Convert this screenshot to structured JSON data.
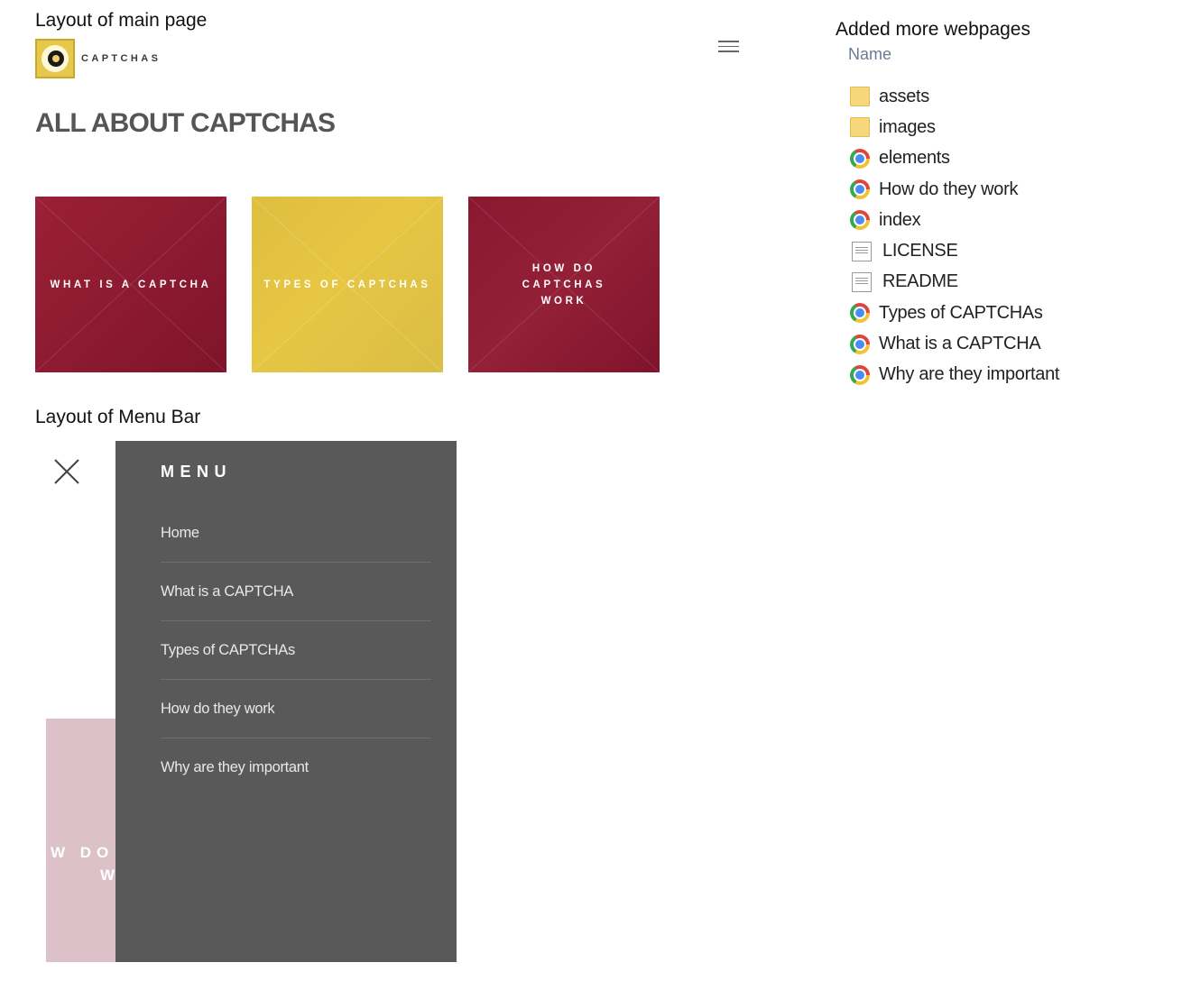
{
  "captions": {
    "main": "Layout of main page",
    "menu": "Layout of Menu Bar",
    "pages": "Added more webpages"
  },
  "main_page": {
    "logo_text": "CAPTCHAS",
    "headline": "ALL ABOUT CAPTCHAS",
    "tiles": [
      {
        "label": "WHAT IS A CAPTCHA",
        "color": "#8c1a30"
      },
      {
        "label": "TYPES OF CAPTCHAS",
        "color": "#e3c443"
      },
      {
        "label": "HOW DO CAPTCHAS WORK",
        "color": "#8a1830"
      }
    ]
  },
  "menu_bar": {
    "title": "MENU",
    "items": [
      "Home",
      "What is a CAPTCHA",
      "Types of CAPTCHAs",
      "How do they work",
      "Why are they important"
    ],
    "background_tile_text_line1": "W DO",
    "background_tile_text_line2": "W",
    "panel_color": "#595959"
  },
  "file_list": {
    "column_header": "Name",
    "files": [
      {
        "name": "assets",
        "icon": "folder-icon"
      },
      {
        "name": "images",
        "icon": "folder-icon"
      },
      {
        "name": "elements",
        "icon": "chrome-icon"
      },
      {
        "name": "How do they work",
        "icon": "chrome-icon"
      },
      {
        "name": "index",
        "icon": "chrome-icon"
      },
      {
        "name": "LICENSE",
        "icon": "document-icon"
      },
      {
        "name": "README",
        "icon": "document-icon"
      },
      {
        "name": "Types of CAPTCHAs",
        "icon": "chrome-icon"
      },
      {
        "name": "What is a CAPTCHA",
        "icon": "chrome-icon"
      },
      {
        "name": "Why are they important",
        "icon": "chrome-icon"
      }
    ]
  }
}
